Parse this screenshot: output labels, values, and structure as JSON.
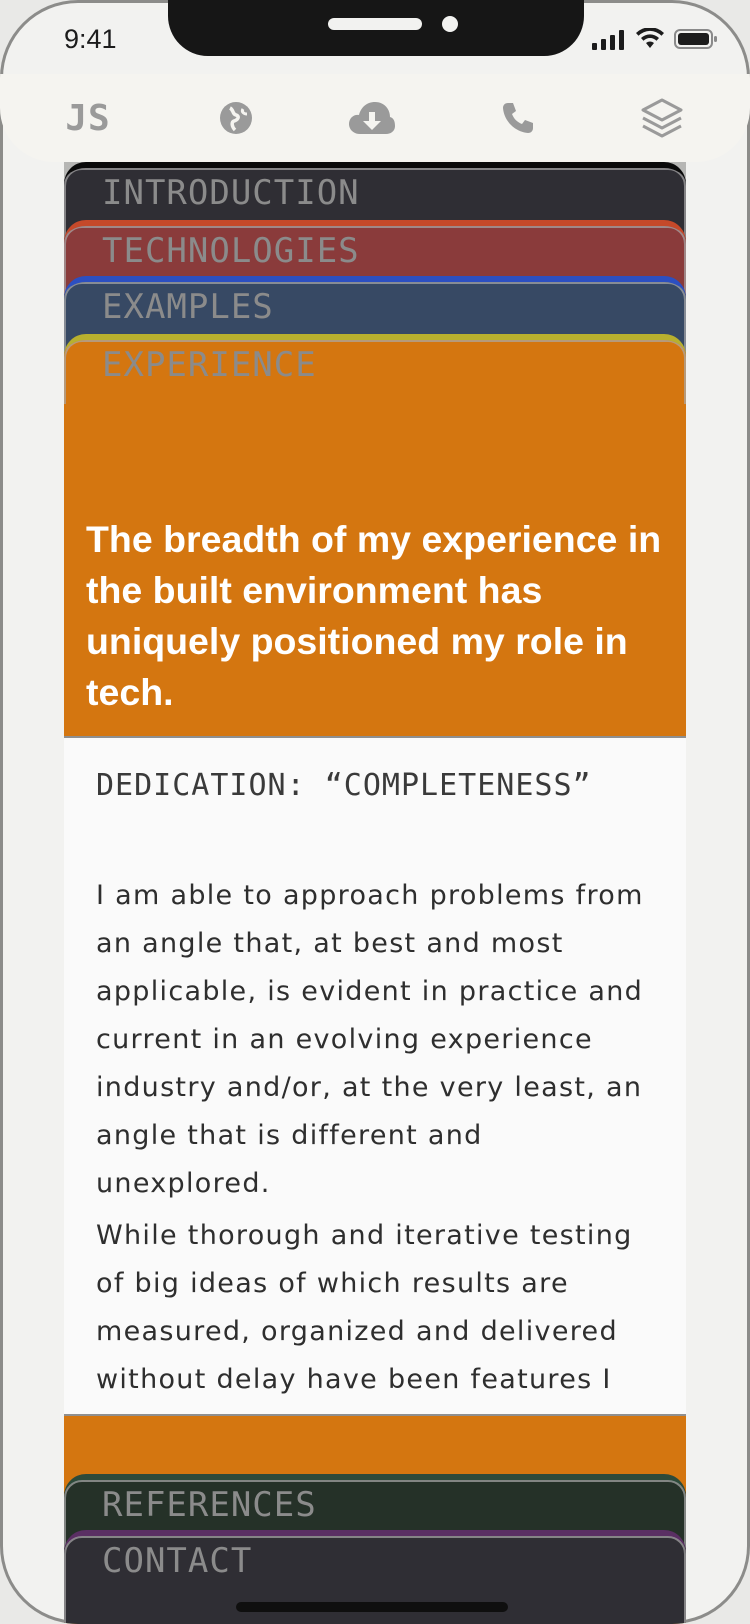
{
  "status": {
    "time": "9:41"
  },
  "nav": {
    "logo": "JS",
    "items": [
      {
        "icon": "globe-icon"
      },
      {
        "icon": "cloud-download-icon"
      },
      {
        "icon": "phone-icon"
      },
      {
        "icon": "layers-icon"
      }
    ]
  },
  "tabs": [
    {
      "label": "INTRODUCTION",
      "bg": "#2f2e34",
      "border": "#0a0a0a"
    },
    {
      "label": "TECHNOLOGIES",
      "bg": "#8a3b3b",
      "border": "#c5492a"
    },
    {
      "label": "EXAMPLES",
      "bg": "#374964",
      "border": "#2c4fc1"
    },
    {
      "label": "EXPERIENCE",
      "bg": "#d47610",
      "border": "#b8b02e"
    }
  ],
  "experience": {
    "headline": "The breadth of my experience in the built environment has uniquely positioned my role in tech.",
    "card_title": "DEDICATION: “COMPLETENESS”",
    "paragraph1": "I am able to approach problems from an angle that, at best and most applicable, is evident in practice and current in an evolving experience industry and/or, at the very least, an angle that is different and unexplored.",
    "paragraph2": "While thorough and iterative testing of big ideas of which results are measured, organized and delivered without delay have been features I"
  },
  "bottom_tabs": [
    {
      "label": "REFERENCES",
      "bg": "#253128",
      "border": "#2d4a3a"
    },
    {
      "label": "CONTACT",
      "bg": "#2f2e34",
      "border": "#5a2f63"
    }
  ]
}
